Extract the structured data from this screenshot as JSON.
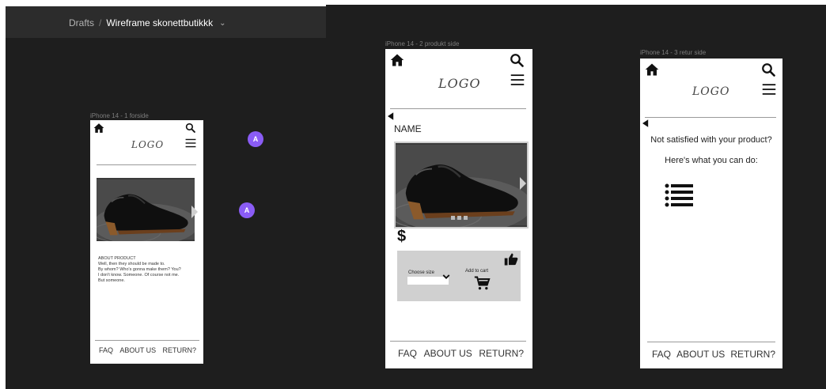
{
  "breadcrumb": {
    "root": "Drafts",
    "file": "Wireframe skonettbutikkk"
  },
  "frames": {
    "forside": {
      "label": "iPhone 14 - 1 forside",
      "logo": "LOGO",
      "about_title": "ABOUT PRODUCT",
      "about_lines": [
        "Well, then they should be made to.",
        "By whom? Who's gonna make them? You?",
        "I don't know. Someone. Of course not me.",
        "But someone."
      ],
      "footer": [
        "FAQ",
        "ABOUT US",
        "RETURN?"
      ]
    },
    "produkt": {
      "label": "iPhone 14 - 2 produkt side",
      "logo": "LOGO",
      "name": "NAME",
      "price_symbol": "$",
      "choose_size": "Choose size",
      "add_to_cart": "Add to cart",
      "footer": [
        "FAQ",
        "ABOUT US",
        "RETURN?"
      ]
    },
    "retur": {
      "label": "iPhone 14 - 3 retur side",
      "logo": "LOGO",
      "question": "Not satisfied with your product?",
      "instructions": "Here's what you can do:",
      "footer": [
        "FAQ",
        "ABOUT US",
        "RETURN?"
      ]
    }
  },
  "avatars": [
    "A",
    "A"
  ],
  "colors": {
    "canvas": "#1e1e1e",
    "toolbar": "#2c2c2c",
    "avatar": "#8a5cf5"
  }
}
